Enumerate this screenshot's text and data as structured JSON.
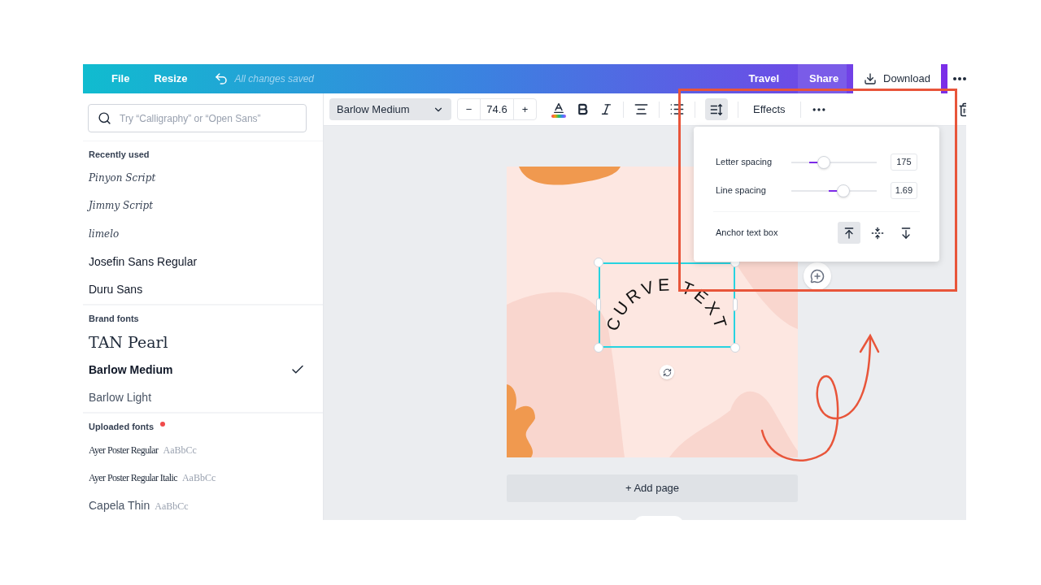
{
  "topbar": {
    "menu": [
      {
        "label": "File"
      },
      {
        "label": "Resize"
      }
    ],
    "status": "All changes saved",
    "actions": [
      {
        "label": "Travel",
        "kind": "plain"
      },
      {
        "label": "Share",
        "kind": "share"
      },
      {
        "label": "Download",
        "kind": "download"
      }
    ]
  },
  "font_panel": {
    "search": {
      "placeholder": "Try “Calligraphy” or “Open Sans”"
    },
    "sections": [
      {
        "title": "Recently used",
        "badge": false,
        "fonts": [
          {
            "name": "Pinyon Script",
            "kind": "script",
            "selected": false
          },
          {
            "name": "Jimmy Script",
            "kind": "script",
            "selected": false
          },
          {
            "name": "limelo",
            "kind": "script",
            "selected": false
          },
          {
            "name": "Josefin Sans Regular",
            "kind": "sans",
            "selected": false
          },
          {
            "name": "Duru Sans",
            "kind": "sans",
            "selected": false
          }
        ]
      },
      {
        "title": "Brand fonts",
        "badge": false,
        "fonts": [
          {
            "name": "TAN Pearl",
            "kind": "serif",
            "selected": false
          },
          {
            "name": "Barlow Medium",
            "kind": "sans",
            "selected": true
          },
          {
            "name": "Barlow Light",
            "kind": "light",
            "selected": false
          }
        ]
      },
      {
        "title": "Uploaded fonts",
        "badge": true,
        "fonts": [
          {
            "name": "Ayer Poster Regular",
            "kind": "condensed",
            "sample": "AaBbCc",
            "selected": false
          },
          {
            "name": "Ayer Poster Regular Italic",
            "kind": "condensed",
            "sample": "AaBbCc",
            "selected": false
          },
          {
            "name": "Capela Thin",
            "kind": "light",
            "sample": "AaBbCc",
            "selected": false
          }
        ]
      }
    ]
  },
  "toolbar": {
    "font": "Barlow Medium",
    "size": "74.6",
    "minus": "−",
    "plus": "+",
    "spacing_selected": true,
    "effects": "Effects"
  },
  "spacing_popover": {
    "sliders": [
      {
        "label": "Letter spacing",
        "level": 0.38,
        "value": "175"
      },
      {
        "label": "Line spacing",
        "level": 0.61,
        "value": "1.69"
      }
    ],
    "anchor": {
      "label": "Anchor text box",
      "options": [
        {
          "kind": "top",
          "selected": true
        },
        {
          "kind": "middle",
          "selected": false
        },
        {
          "kind": "bottom",
          "selected": false
        }
      ]
    }
  },
  "canvas": {
    "curved_text": "CURVE TEXT",
    "add_page": "+ Add page"
  }
}
